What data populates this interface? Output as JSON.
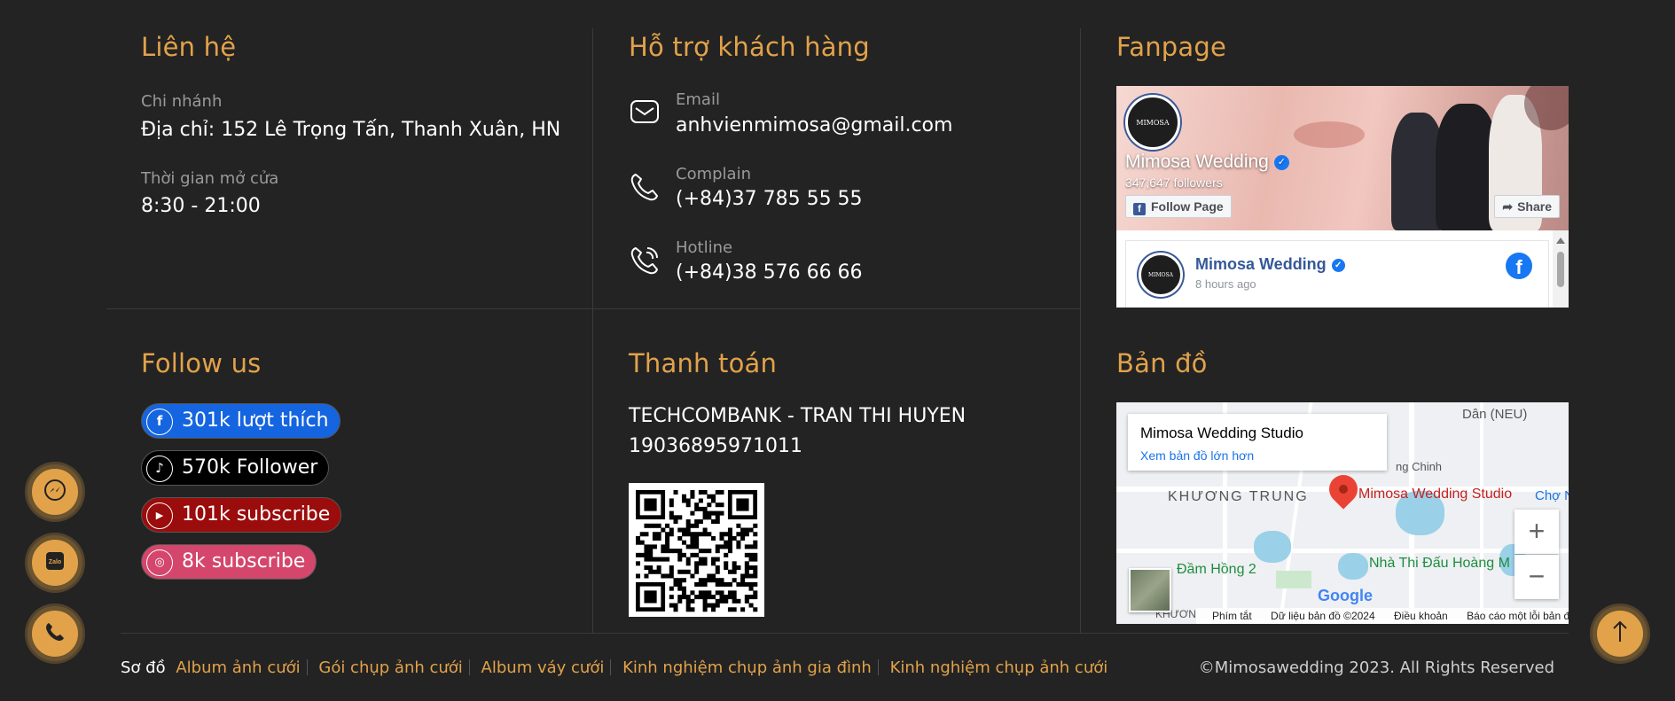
{
  "contact": {
    "title": "Liên hệ",
    "branch_label": "Chi nhánh",
    "branch_value": "Địa chỉ: 152 Lê Trọng Tấn, Thanh Xuân, HN",
    "hours_label": "Thời gian mở cửa",
    "hours_value": "8:30 - 21:00"
  },
  "support": {
    "title": "Hỗ trợ khách hàng",
    "email_label": "Email",
    "email_value": "anhvienmimosa@gmail.com",
    "complain_label": "Complain",
    "complain_value": "(+84)37 785 55 55",
    "hotline_label": "Hotline",
    "hotline_value": "(+84)38 576 66 66"
  },
  "fanpage": {
    "title": "Fanpage",
    "page_name": "Mimosa Wedding",
    "followers": "347,647 followers",
    "follow_button": "Follow Page",
    "share_button": "Share",
    "post_name": "Mimosa Wedding",
    "post_time": "8 hours ago",
    "avatar_text": "MIMOSA"
  },
  "follow": {
    "title": "Follow us",
    "items": [
      {
        "label": "301k lượt thích",
        "icon": "facebook-icon",
        "color": "#1565e0"
      },
      {
        "label": "570k Follower",
        "icon": "tiktok-icon",
        "color": "#000000"
      },
      {
        "label": "101k subscribe",
        "icon": "youtube-icon",
        "color": "#9b0c0c"
      },
      {
        "label": "8k subscribe",
        "icon": "instagram-icon",
        "color": "#d4466b"
      }
    ]
  },
  "payment": {
    "title": "Thanh toán",
    "bank": "TECHCOMBANK - TRAN THI HUYEN",
    "account": "19036895971011"
  },
  "map": {
    "title": "Bản đồ",
    "place_name": "Mimosa Wedding Studio",
    "larger_map_link": "Xem bản đồ lớn hơn",
    "pin_label": "Mimosa Wedding Studio",
    "district_label": "KHƯƠNG TRUNG",
    "lake_label": "Đầm Hồng 2",
    "venue_label": "Nhà Thi Đấu Hoàng M",
    "market_label": "Chợ N",
    "area_label": "Dân (NEU)",
    "street_label": "ng Chinh",
    "bottom_label": "KHƯƠN",
    "shortcut": "Phím tắt",
    "map_data": "Dữ liệu bản đồ ©2024",
    "terms": "Điều khoản",
    "report": "Báo cáo một lỗi bản đồ",
    "zoom_in": "+",
    "zoom_out": "−",
    "google": "Google"
  },
  "footer": {
    "sitemap_label": "Sơ đồ",
    "links": [
      "Album ảnh cưới",
      "Gói chụp ảnh cưới",
      "Album váy cưới",
      "Kinh nghiệm chụp ảnh gia đình",
      "Kinh nghiệm chụp ảnh cưới"
    ],
    "copyright": "©Mimosawedding 2023. All Rights Reserved"
  },
  "colors": {
    "background": "#232323",
    "accent": "#e2a24a"
  }
}
